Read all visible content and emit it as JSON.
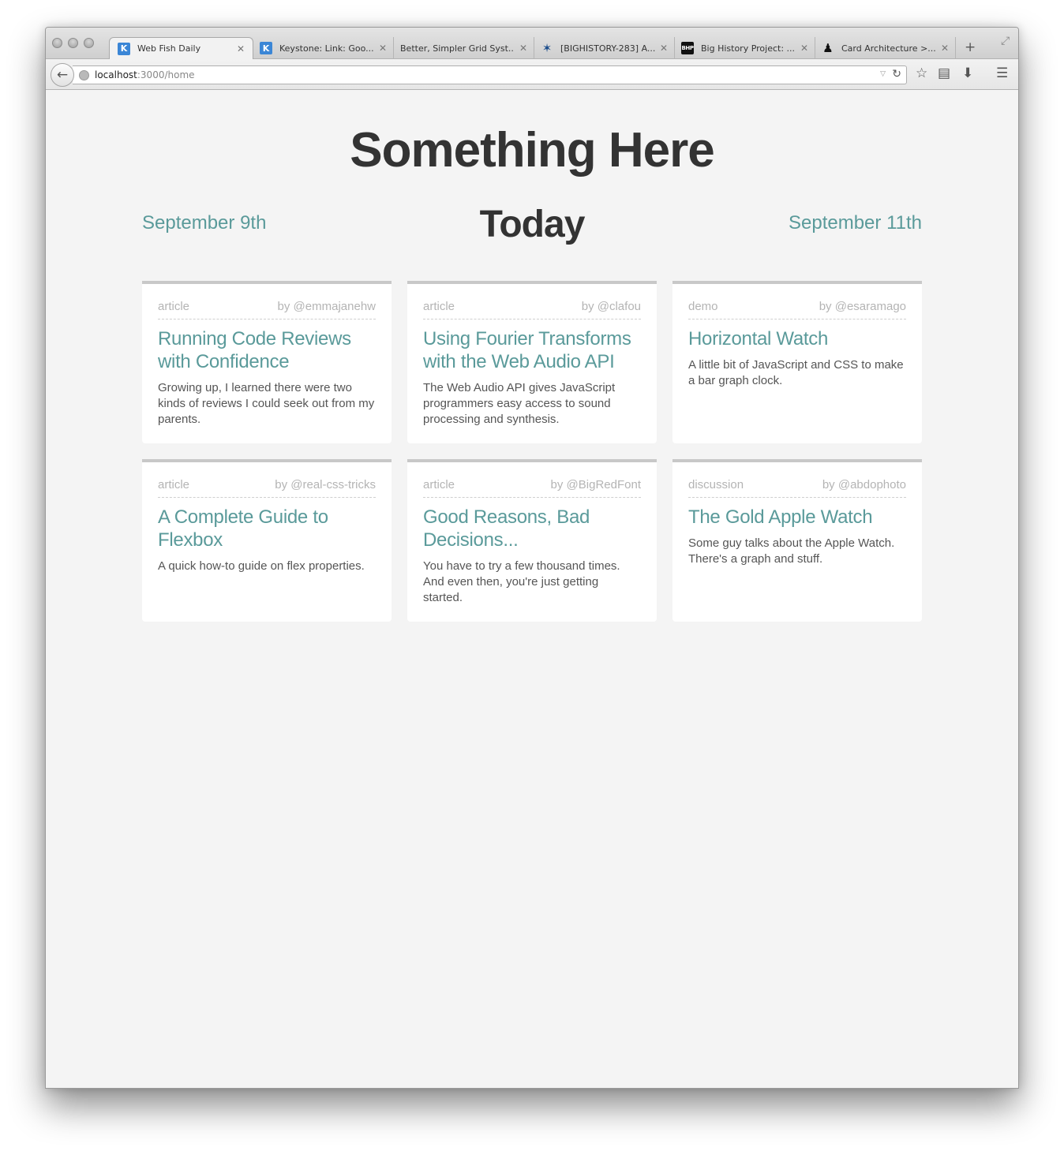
{
  "browser": {
    "tabs": [
      {
        "title": "Web Fish Daily",
        "icon": "keystone-k-icon",
        "glyph": "K",
        "active": true
      },
      {
        "title": "Keystone: Link: Goo...",
        "icon": "keystone-k-icon",
        "glyph": "K",
        "active": false
      },
      {
        "title": "Better, Simpler Grid Syst...",
        "icon": "",
        "glyph": "",
        "active": false
      },
      {
        "title": "[BIGHISTORY-283] A...",
        "icon": "jira-icon",
        "glyph": "✶",
        "active": false
      },
      {
        "title": "Big History Project: ...",
        "icon": "bhp-logo-icon",
        "glyph": "BHP",
        "active": false
      },
      {
        "title": "Card Architecture >...",
        "icon": "silhouette-icon",
        "glyph": "♟",
        "active": false
      }
    ],
    "url_host": "localhost",
    "url_path": ":3000/home"
  },
  "page": {
    "title": "Something Here",
    "date_prev": "September 9th",
    "date_current": "Today",
    "date_next": "September 11th"
  },
  "cards": [
    {
      "type": "article",
      "author": "by @emmajanehw",
      "title": "Running Code Reviews with Confidence",
      "description": "Growing up, I learned there were two kinds of reviews I could seek out from my parents."
    },
    {
      "type": "article",
      "author": "by @clafou",
      "title": "Using Fourier Transforms with the Web Audio API",
      "description": "The Web Audio API gives JavaScript programmers easy access to sound processing and synthesis."
    },
    {
      "type": "demo",
      "author": "by @esaramago",
      "title": "Horizontal Watch",
      "description": "A little bit of JavaScript and CSS to make a bar graph clock."
    },
    {
      "type": "article",
      "author": "by @real-css-tricks",
      "title": "A Complete Guide to Flexbox",
      "description": "A quick how-to guide on flex properties."
    },
    {
      "type": "article",
      "author": "by @BigRedFont",
      "title": "Good Reasons, Bad Decisions...",
      "description": "You have to try a few thousand times. And even then, you're just getting started."
    },
    {
      "type": "discussion",
      "author": "by @abdophoto",
      "title": "The Gold Apple Watch",
      "description": "Some guy talks about the Apple Watch. There's a graph and stuff."
    }
  ],
  "colors": {
    "accent": "#5a9a9a",
    "heading": "#333333",
    "meta": "#b4b4b4",
    "background": "#f4f4f4"
  }
}
